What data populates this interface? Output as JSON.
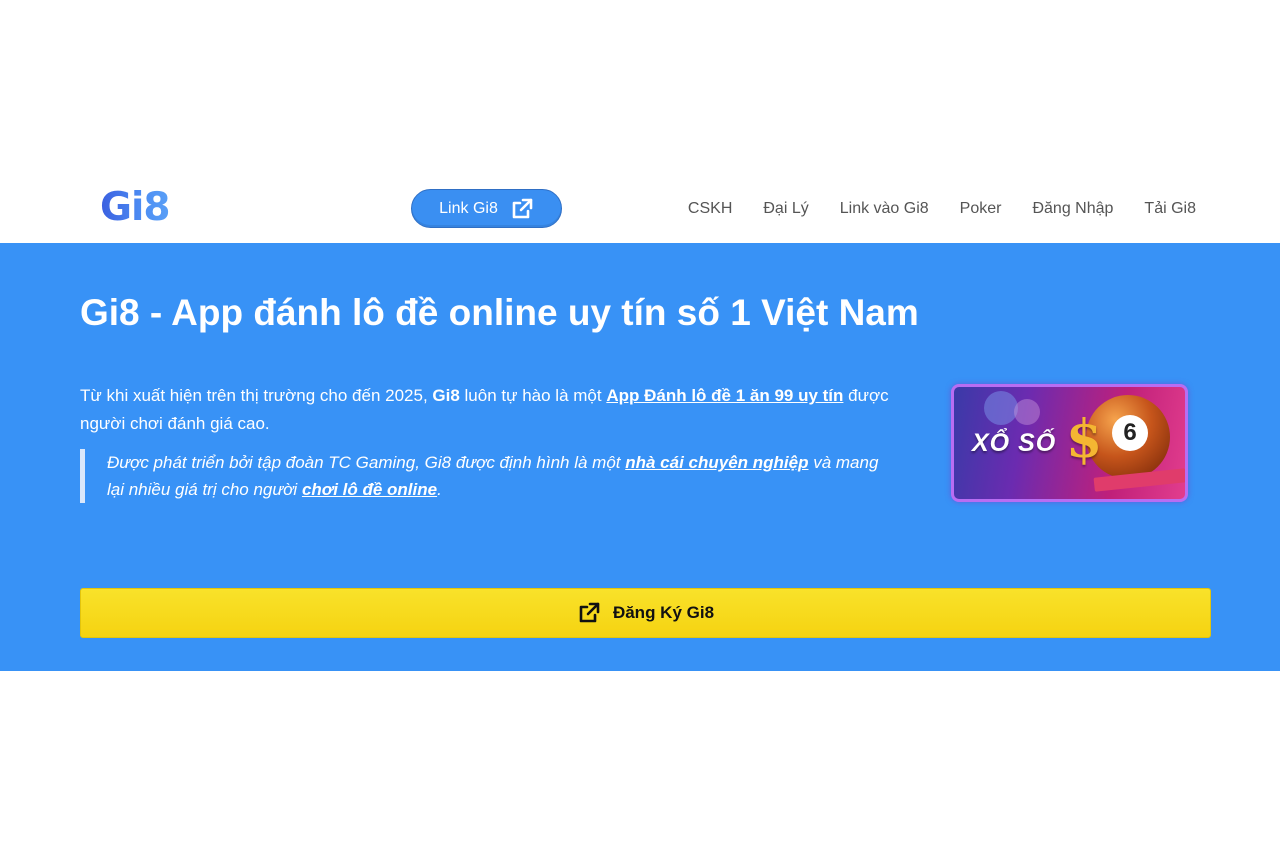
{
  "header": {
    "logo_text": "Gi8",
    "link_button_label": "Link Gi8",
    "nav": [
      "CSKH",
      "Đại Lý",
      "Link vào Gi8",
      "Poker",
      "Đăng Nhập",
      "Tải Gi8"
    ]
  },
  "hero": {
    "title": "Gi8 - App đánh lô đề online uy tín số 1 Việt Nam",
    "intro": {
      "text_before": "Từ khi xuất hiện trên thị trường cho đến 2025, ",
      "brand": "Gi8",
      "text_middle": " luôn tự hào là một ",
      "link": "App Đánh lô đề 1 ăn 99 uy tín",
      "text_after": " được người chơi đánh giá cao."
    },
    "quote": {
      "text_before": "Được phát triển bởi tập đoàn TC Gaming, Gi8 được định hình là một ",
      "link1": "nhà cái chuyên nghiệp",
      "text_middle": " và mang lại nhiều giá trị cho người ",
      "link2": "chơi lô đề online",
      "text_after": "."
    },
    "promo": {
      "label": "XỔ SỐ",
      "ball_number": "6",
      "symbol": "$"
    },
    "register_button_label": "Đăng Ký Gi8"
  },
  "colors": {
    "hero_background": "#3892f6",
    "link_button": "#3a8ff2",
    "register_button": "#f9e22a",
    "nav_text": "#555555"
  },
  "icons": {
    "link_button_icon": "external-link-icon",
    "register_button_icon": "external-link-icon"
  }
}
